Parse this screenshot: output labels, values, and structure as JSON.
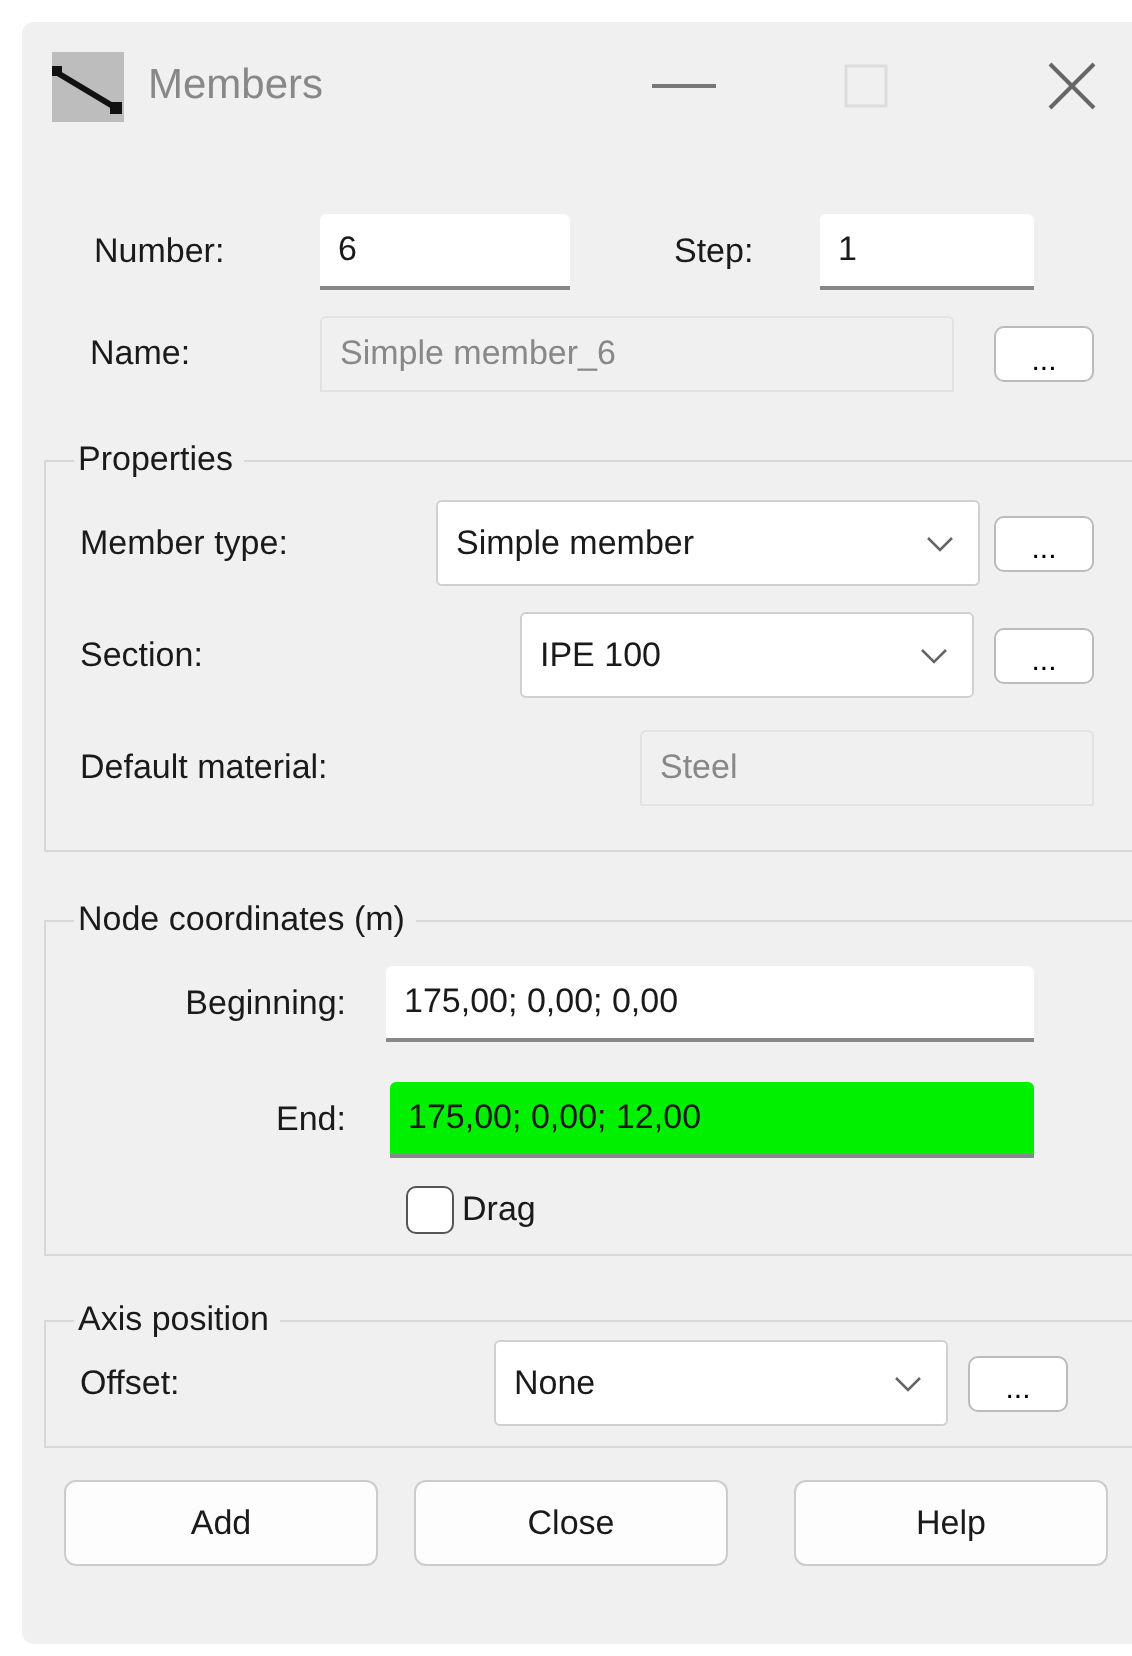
{
  "window": {
    "title": "Members"
  },
  "number": {
    "label": "Number:",
    "value": "6"
  },
  "step": {
    "label": "Step:",
    "value": "1"
  },
  "name": {
    "label": "Name:",
    "value": "Simple member_6",
    "disabled": true,
    "browse": "..."
  },
  "properties": {
    "legend": "Properties",
    "member_type": {
      "label": "Member type:",
      "value": "Simple member",
      "browse": "..."
    },
    "section": {
      "label": "Section:",
      "value": "IPE 100",
      "browse": "..."
    },
    "default_material": {
      "label": "Default material:",
      "value": "Steel",
      "disabled": true
    }
  },
  "node_coordinates": {
    "legend": "Node coordinates (m)",
    "beginning": {
      "label": "Beginning:",
      "value": "175,00; 0,00; 0,00",
      "highlighted": false
    },
    "end": {
      "label": "End:",
      "value": "175,00; 0,00; 12,00",
      "highlighted": true
    },
    "drag": {
      "label": "Drag",
      "checked": false
    }
  },
  "axis_position": {
    "legend": "Axis position",
    "offset": {
      "label": "Offset:",
      "value": "None",
      "browse": "..."
    }
  },
  "buttons": [
    "Add",
    "Close",
    "Help"
  ]
}
